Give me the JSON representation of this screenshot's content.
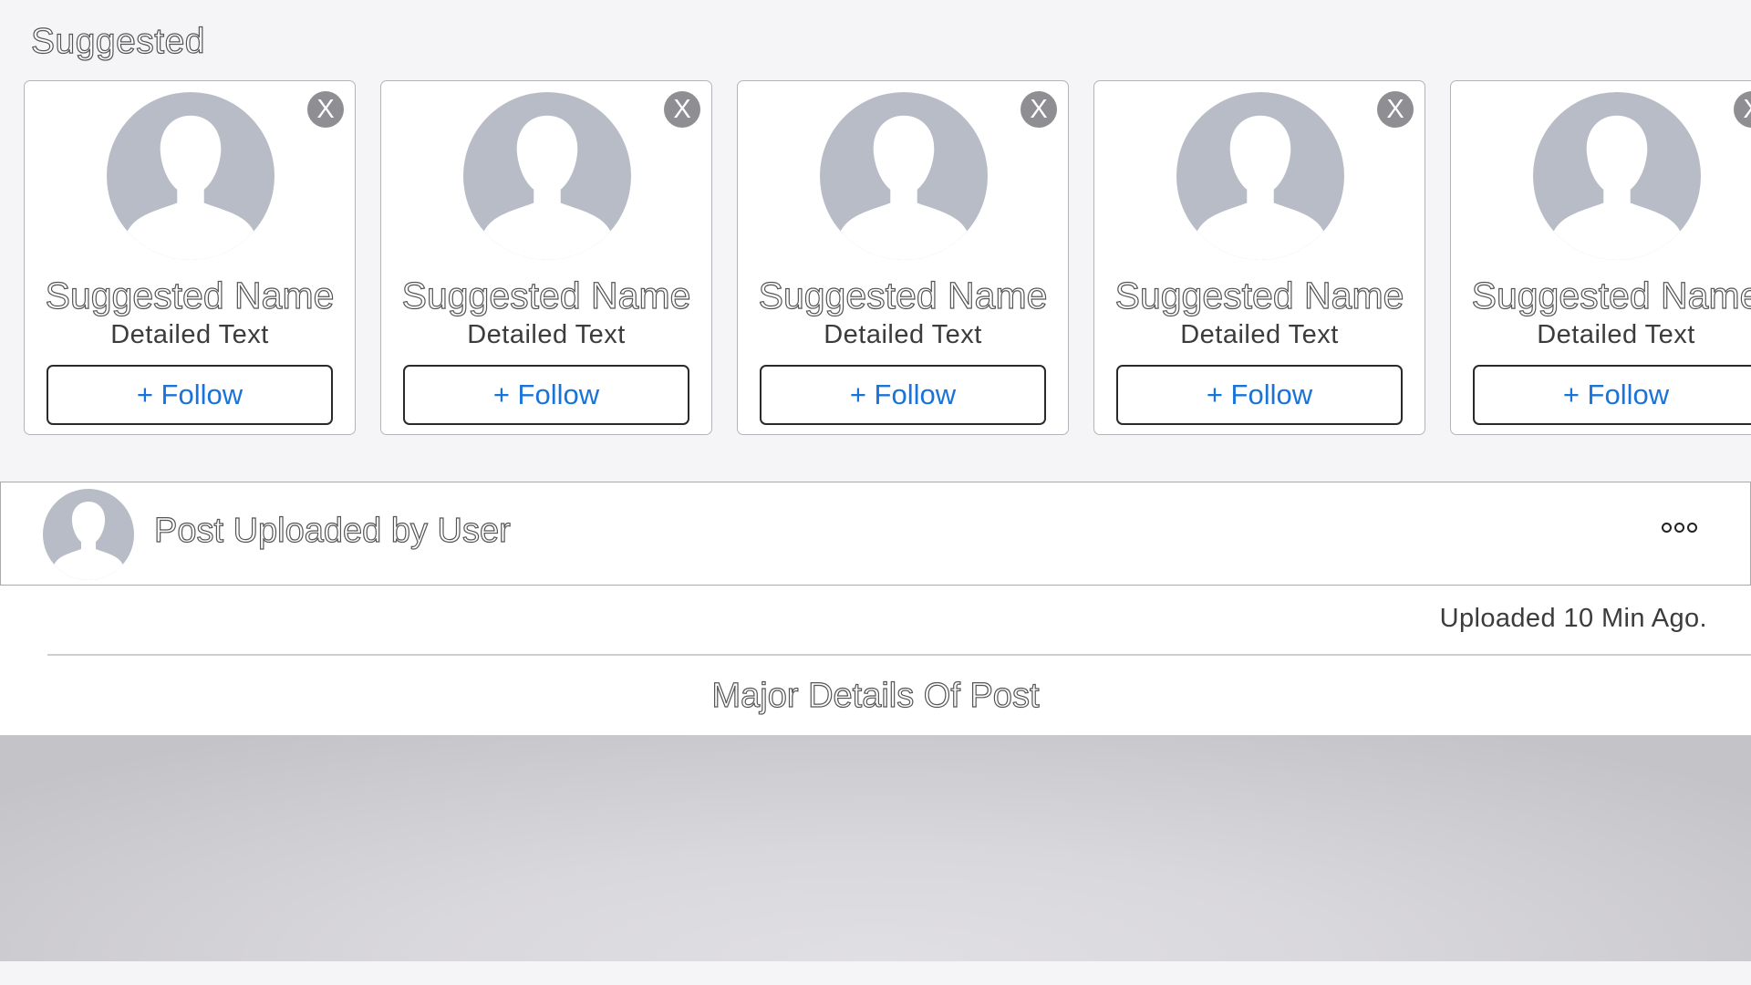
{
  "suggested": {
    "title": "Suggested",
    "dismiss_label": "X",
    "cards": [
      {
        "name": "Suggested Name",
        "detail": "Detailed Text",
        "follow_label": "+ Follow"
      },
      {
        "name": "Suggested Name",
        "detail": "Detailed Text",
        "follow_label": "+ Follow"
      },
      {
        "name": "Suggested Name",
        "detail": "Detailed Text",
        "follow_label": "+ Follow"
      },
      {
        "name": "Suggested Name",
        "detail": "Detailed Text",
        "follow_label": "+ Follow"
      },
      {
        "name": "Suggested Name",
        "detail": "Detailed Text",
        "follow_label": "+ Follow"
      }
    ]
  },
  "post": {
    "title": "Post Uploaded by User",
    "more_icon": "ellipsis-icon",
    "timestamp": "Uploaded 10 Min Ago.",
    "details": "Major Details Of Post"
  },
  "colors": {
    "accent": "#1a73d9",
    "avatar": "#b8bcc6",
    "dismiss": "#8e8e93",
    "background": "#f5f5f7"
  },
  "icons": {
    "avatar": "person-silhouette-icon",
    "dismiss": "close-icon"
  }
}
